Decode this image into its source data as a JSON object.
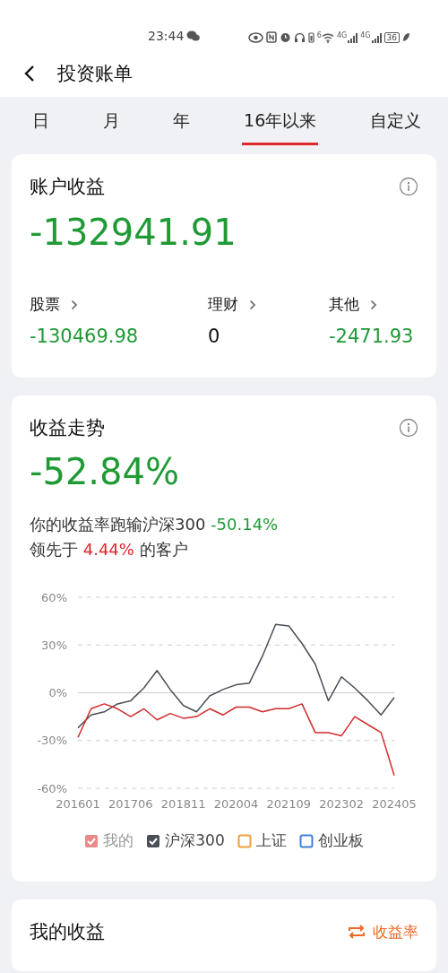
{
  "status_bar": {
    "time": "23:44",
    "wifi_label": "6",
    "signal_labels": [
      "4G",
      "4G"
    ],
    "battery": "36"
  },
  "header": {
    "title": "投资账单"
  },
  "tabs": [
    {
      "label": "日",
      "selected": false
    },
    {
      "label": "月",
      "selected": false
    },
    {
      "label": "年",
      "selected": false
    },
    {
      "label": "16年以来",
      "selected": true
    },
    {
      "label": "自定义",
      "selected": false
    }
  ],
  "account_card": {
    "title": "账户收益",
    "total": {
      "text": "-132941.91",
      "color": "#1f9a35"
    },
    "breakdown": [
      {
        "label": "股票",
        "value": "-130469.98",
        "color": "#1f9a35"
      },
      {
        "label": "理财",
        "value": "0",
        "color": "#111111"
      },
      {
        "label": "其他",
        "value": "-2471.93",
        "color": "#1f9a35"
      }
    ]
  },
  "trend_card": {
    "title": "收益走势",
    "rate": {
      "text": "-52.84%",
      "color": "#1f9a35"
    },
    "comparisons": [
      {
        "before": "你的收益率跑输沪深300",
        "value": "-50.14%",
        "color": "#1f9a35"
      },
      {
        "before": "领先于",
        "value": "4.44%",
        "color": "#e0262b",
        "after": "的客户"
      }
    ],
    "chart_data": {
      "type": "line",
      "categories": [
        "201601",
        null,
        null,
        null,
        "201706",
        null,
        null,
        null,
        "201811",
        null,
        null,
        null,
        "202004",
        null,
        null,
        null,
        "202109",
        null,
        null,
        null,
        "202302",
        null,
        null,
        null,
        "202405"
      ],
      "yticks": [
        {
          "value": 60,
          "label": "60%"
        },
        {
          "value": 30,
          "label": "30%"
        },
        {
          "value": 0,
          "label": "0%"
        },
        {
          "value": -30,
          "label": "-30%"
        },
        {
          "value": -60,
          "label": "-60%"
        }
      ],
      "ylim": [
        -60,
        60
      ],
      "series": [
        {
          "name": "我的",
          "color": "#d42a2a",
          "values": [
            -28,
            -10,
            -7,
            -10,
            -15,
            -10,
            -17,
            -13,
            -16,
            -15,
            -10,
            -14,
            -9,
            -9,
            -12,
            -10,
            -10,
            -7,
            -25,
            -25,
            -27,
            -15,
            -20,
            -25,
            -52
          ]
        },
        {
          "name": "沪深300",
          "color": "#4a4f57",
          "values": [
            -22,
            -14,
            -12,
            -7,
            -5,
            3,
            14,
            2,
            -8,
            -12,
            -2,
            2,
            5,
            6,
            23,
            43,
            42,
            31,
            18,
            -5,
            10,
            3,
            -5,
            -14,
            -3
          ]
        }
      ]
    },
    "legend": [
      {
        "checked": true,
        "faded": true,
        "color": "#e88a8a"
      },
      {
        "checked": true,
        "faded": false,
        "color": "#4a4f57"
      },
      {
        "label": "上证",
        "checked": false,
        "faded": false,
        "color": "#f2a03d"
      },
      {
        "label": "创业板",
        "checked": false,
        "faded": false,
        "color": "#3f7fe0"
      }
    ]
  },
  "earnings_card": {
    "title": "我的收益",
    "toggle": "收益率"
  }
}
